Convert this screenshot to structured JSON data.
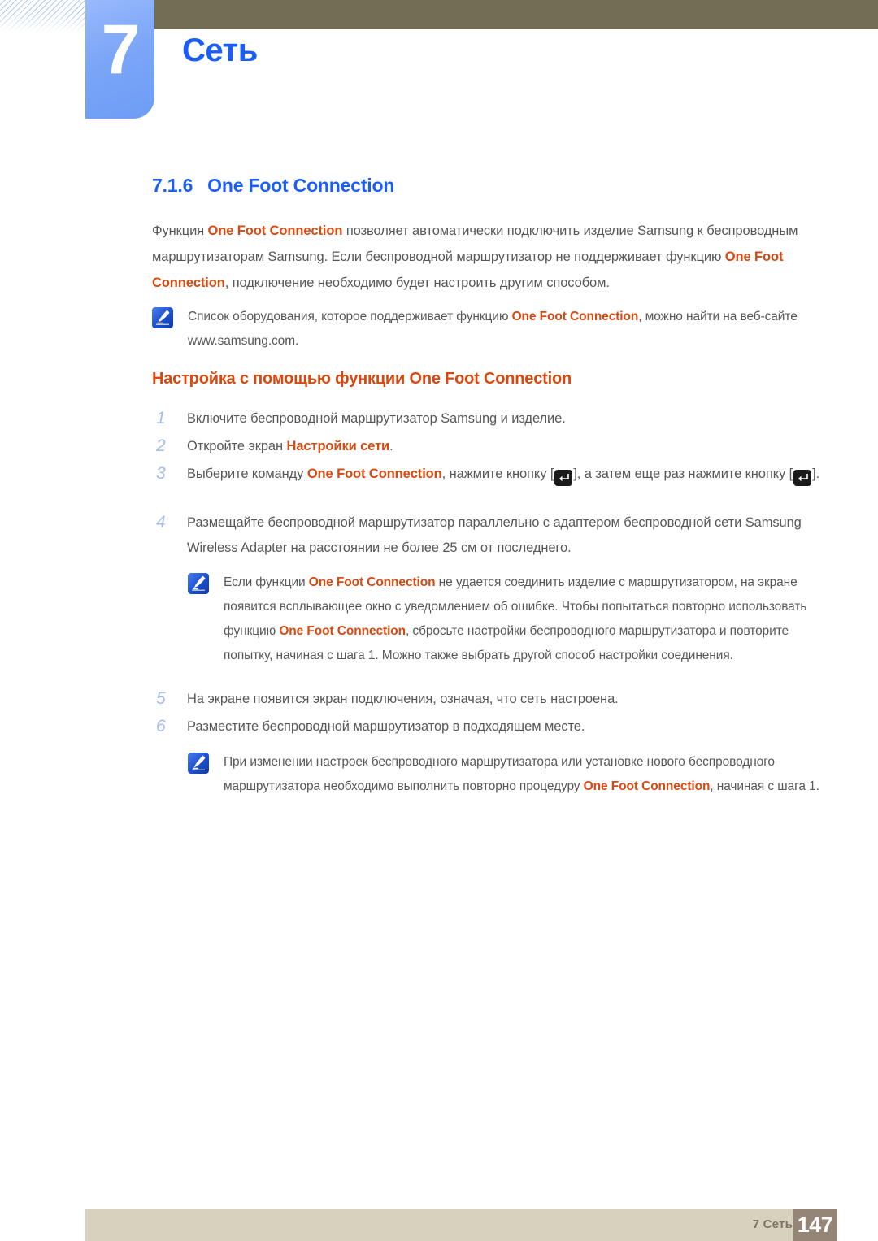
{
  "header": {
    "chapter_number": "7",
    "chapter_title": "Сеть"
  },
  "section": {
    "number": "7.1.6",
    "title": "One Foot Connection"
  },
  "intro_paragraph": {
    "part1": "Функция ",
    "bold1": "One Foot Connection",
    "part2": " позволяет автоматически подключить изделие Samsung к беспроводным маршрутизаторам Samsung. Если беспроводной маршрутизатор не поддерживает функцию ",
    "bold2": "One Foot Connection",
    "part3": ", подключение необходимо будет настроить другим способом."
  },
  "note_1": {
    "icon": "note-pen-icon",
    "part1": "Список оборудования, которое поддерживает функцию ",
    "bold1": "One Foot Connection",
    "part2": ", можно найти на веб-сайте www.samsung.com."
  },
  "sub_heading": "Настройка с помощью функции One Foot Connection",
  "steps": [
    {
      "number": "1",
      "part1": "Включите беспроводной маршрутизатор Samsung и изделие."
    },
    {
      "number": "2",
      "part1": "Откройте экран ",
      "bold1": "Настройки сети",
      "part2": "."
    },
    {
      "number": "3",
      "part1": "Выберите команду ",
      "bold1": "One Foot Connection",
      "part2": ", нажмите кнопку [",
      "key1": "enter-key-icon",
      "part3": "], а затем еще раз нажмите кнопку [",
      "key2": "enter-key-icon",
      "part4": "]."
    },
    {
      "number": "4",
      "part1": "Размещайте беспроводной маршрутизатор параллельно с адаптером беспроводной сети Samsung Wireless Adapter на расстоянии не более 25 см от последнего."
    },
    {
      "number": "5",
      "part1": "На экране появится экран подключения, означая, что сеть настроена."
    },
    {
      "number": "6",
      "part1": "Разместите беспроводной маршрутизатор в подходящем месте."
    }
  ],
  "note_2": {
    "icon": "note-pen-icon",
    "part1": "Если функции ",
    "bold1": "One Foot Connection",
    "part2": " не удается соединить изделие с маршрутизатором, на экране появится всплывающее окно с уведомлением об ошибке. Чтобы попытаться повторно использовать функцию ",
    "bold2": "One Foot Connection",
    "part3": ", сбросьте настройки беспроводного маршрутизатора и повторите попытку, начиная с шага 1. Можно также выбрать другой способ настройки соединения."
  },
  "note_3": {
    "icon": "note-pen-icon",
    "part1": "При изменении настроек беспроводного маршрутизатора или установке нового беспроводного маршрутизатора необходимо выполнить повторно процедуру ",
    "bold1": "One Foot Connection",
    "part2": ", начиная с шага 1."
  },
  "footer": {
    "label": "7 Сеть",
    "page_number": "147"
  },
  "colors": {
    "accent_blue": "#1b5ef7",
    "accent_orange": "#d9480f",
    "body_text": "#58585a",
    "olive_bar": "#716e55",
    "footer_bar": "#d7d2bd",
    "page_box": "#948576",
    "step_number": "#a8bde8"
  }
}
